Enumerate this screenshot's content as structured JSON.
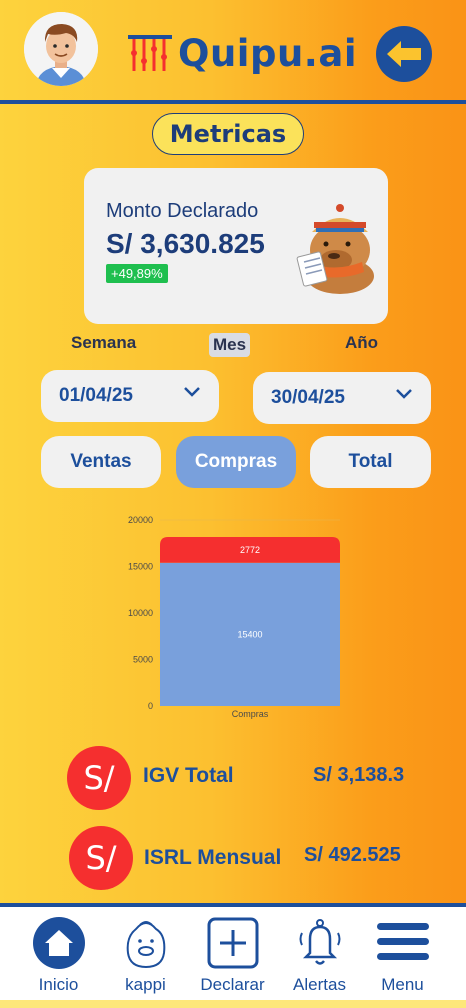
{
  "header": {
    "logo_text": "Quipu.ai",
    "avatar_icon": "user-avatar",
    "back_icon": "arrow-left-icon",
    "brand_color": "#1d4f9c"
  },
  "page_title": "Metricas",
  "summary_card": {
    "label": "Monto Declarado",
    "amount": "S/ 3,630.825",
    "change_badge": "+49,89%",
    "badge_color": "#1fbf4f",
    "mascot_icon": "capybara-mascot"
  },
  "period_selector": {
    "options": [
      "Semana",
      "Mes",
      "Año"
    ],
    "selected": "Mes"
  },
  "date_range": {
    "start": "01/04/25",
    "end": "30/04/25"
  },
  "tabs": {
    "items": [
      "Ventas",
      "Compras",
      "Total"
    ],
    "selected": "Compras"
  },
  "chart_data": {
    "type": "bar",
    "stacked": true,
    "categories": [
      "Compras"
    ],
    "series": [
      {
        "values": [
          15400
        ],
        "color": "#79a0dc"
      },
      {
        "values": [
          2772
        ],
        "color": "#f52f2f"
      }
    ],
    "y_ticks": [
      0,
      5000,
      10000,
      15000,
      20000
    ],
    "ylim": [
      0,
      20000
    ],
    "title": "",
    "xlabel": "",
    "ylabel": ""
  },
  "taxes": [
    {
      "icon_text": "S/",
      "label": "IGV Total",
      "value": "S/ 3,138.3"
    },
    {
      "icon_text": "S/",
      "label": "ISRL Mensual",
      "value": "S/ 492.525"
    }
  ],
  "bottom_nav": [
    {
      "label": "Inicio",
      "icon": "home-icon"
    },
    {
      "label": "kappi",
      "icon": "capybara-icon"
    },
    {
      "label": "Declarar",
      "icon": "plus-square-icon"
    },
    {
      "label": "Alertas",
      "icon": "bell-icon"
    },
    {
      "label": "Menu",
      "icon": "hamburger-menu-icon"
    }
  ]
}
